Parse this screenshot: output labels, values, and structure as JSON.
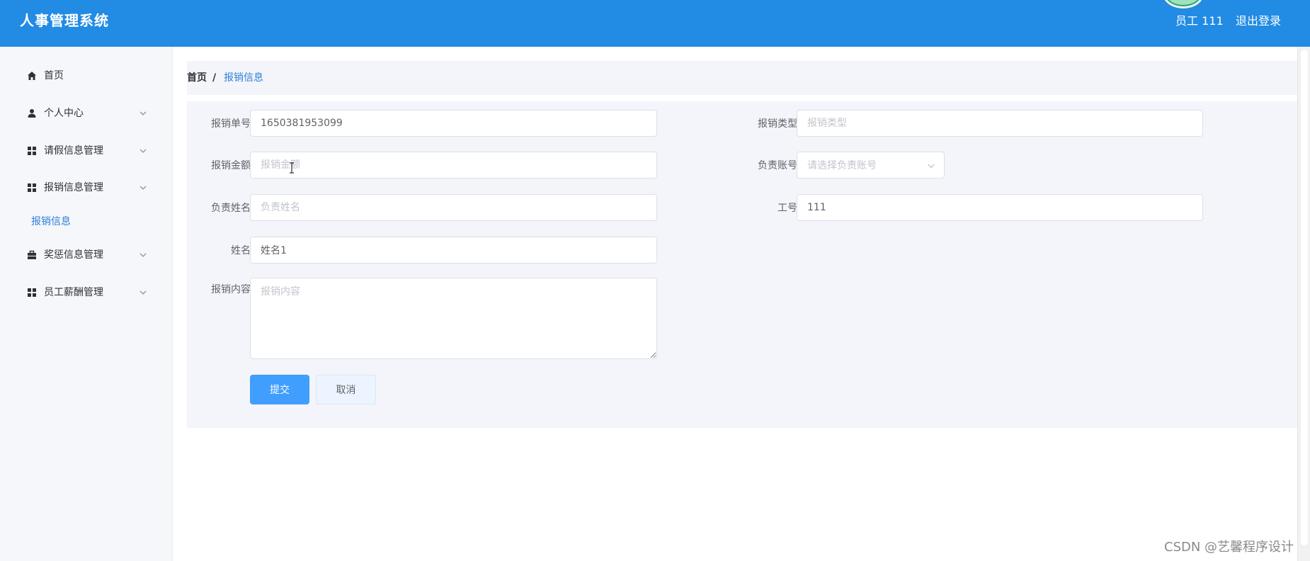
{
  "header": {
    "app_title": "人事管理系统",
    "user_label": "员工 111",
    "logout_label": "退出登录"
  },
  "sidebar": {
    "items": [
      {
        "label": "首页",
        "icon": "home-icon",
        "has_chevron": false
      },
      {
        "label": "个人中心",
        "icon": "user-icon",
        "has_chevron": true
      },
      {
        "label": "请假信息管理",
        "icon": "grid-icon",
        "has_chevron": true
      },
      {
        "label": "报销信息管理",
        "icon": "grid-icon",
        "has_chevron": true
      },
      {
        "label": "奖惩信息管理",
        "icon": "briefcase-icon",
        "has_chevron": true
      },
      {
        "label": "员工薪酬管理",
        "icon": "grid-icon",
        "has_chevron": true
      }
    ],
    "active_sub_item": "报销信息"
  },
  "breadcrumb": {
    "home": "首页",
    "separator": "/",
    "current": "报销信息"
  },
  "form": {
    "fields": {
      "reimburse_no": {
        "label": "报销单号",
        "value": "1650381953099",
        "placeholder": ""
      },
      "reimburse_type": {
        "label": "报销类型",
        "value": "",
        "placeholder": "报销类型"
      },
      "reimburse_amount": {
        "label": "报销金额",
        "value": "",
        "placeholder": "报销金额"
      },
      "responsible_account": {
        "label": "负责账号",
        "value": "",
        "placeholder": "请选择负责账号"
      },
      "responsible_name": {
        "label": "负责姓名",
        "value": "",
        "placeholder": "负责姓名"
      },
      "employee_no": {
        "label": "工号",
        "value": "111",
        "placeholder": ""
      },
      "name": {
        "label": "姓名",
        "value": "姓名1",
        "placeholder": ""
      },
      "reimburse_content": {
        "label": "报销内容",
        "value": "",
        "placeholder": "报销内容"
      }
    },
    "submit_label": "提交",
    "cancel_label": "取消"
  },
  "watermark": "CSDN @艺馨程序设计",
  "colors": {
    "header_bg": "#228be4",
    "sidebar_bg": "#f6f7fb",
    "panel_bg": "#f4f5fa",
    "primary": "#409eff",
    "active_link": "#2b7fd8"
  }
}
